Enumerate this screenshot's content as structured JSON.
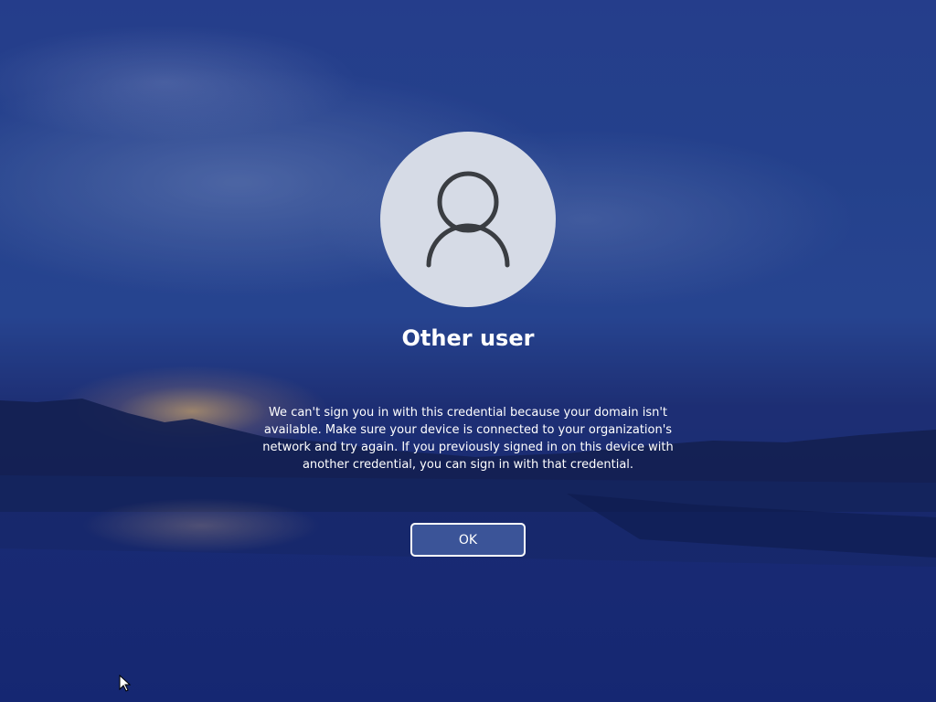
{
  "user": {
    "name": "Other user",
    "avatar_icon": "person-icon"
  },
  "message": {
    "text": "We can't sign you in with this credential because your domain isn't available. Make sure your device is connected to your organization's network and try again. If you previously signed in on this device with another credential, you can sign in with that credential."
  },
  "actions": {
    "ok_label": "OK"
  },
  "cursor": {
    "icon": "mouse-pointer-icon"
  },
  "colors": {
    "avatar_background": "#d6dbe6",
    "avatar_glyph": "#3a3d42",
    "button_border": "#ffffff"
  }
}
